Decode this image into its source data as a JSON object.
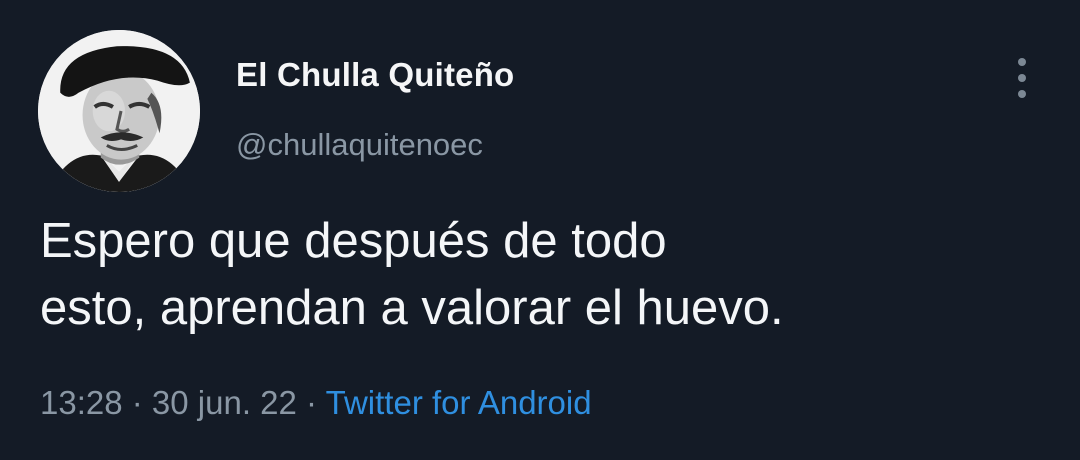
{
  "tweet": {
    "display_name": "El Chulla Quiteño",
    "handle": "@chullaquitenoec",
    "avatar_icon": "profile-photo",
    "more_icon": "vertical-ellipsis-icon",
    "text_line1": "Espero que después de todo",
    "text_line2": "esto, aprendan a valorar el huevo.",
    "time": "13:28",
    "separator": " · ",
    "date": "30 jun. 22",
    "source": "Twitter for Android"
  },
  "colors": {
    "background": "#141b26",
    "primary_text": "#f4f6f8",
    "secondary_text": "#8a97a4",
    "link": "#2f8fe0"
  }
}
